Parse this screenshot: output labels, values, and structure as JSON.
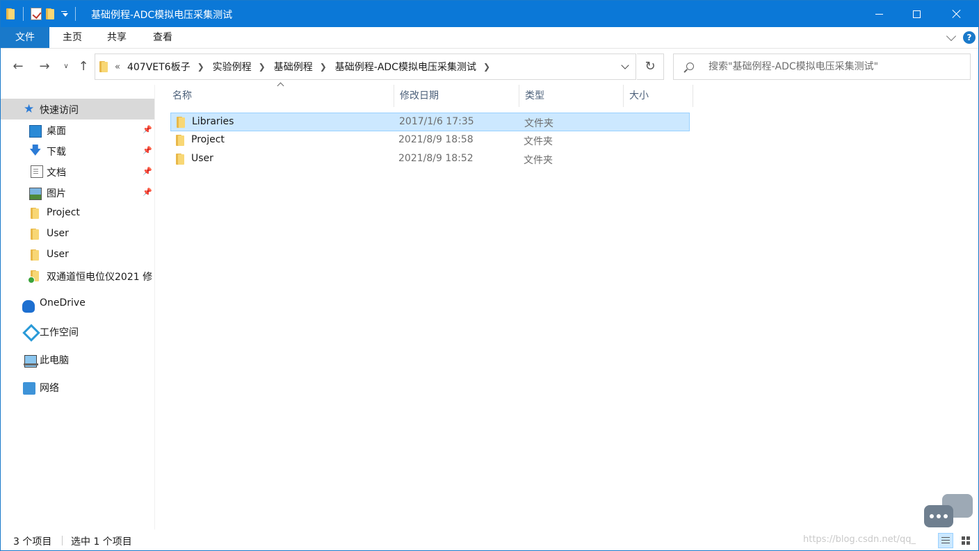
{
  "window": {
    "title": "基础例程-ADC模拟电压采集测试"
  },
  "ribbon": {
    "tabs": [
      {
        "label": "文件"
      },
      {
        "label": "主页"
      },
      {
        "label": "共享"
      },
      {
        "label": "查看"
      }
    ],
    "help": "?"
  },
  "navigation": {
    "overflow": "«",
    "breadcrumbs": [
      {
        "label": "407VET6板子"
      },
      {
        "label": "实验例程"
      },
      {
        "label": "基础例程"
      },
      {
        "label": "基础例程-ADC模拟电压采集测试"
      }
    ],
    "search_placeholder": "搜索\"基础例程-ADC模拟电压采集测试\""
  },
  "sidebar": {
    "items": [
      {
        "label": "快速访问",
        "icon": "star-icon"
      },
      {
        "label": "桌面",
        "icon": "desktop-icon",
        "pinned": true
      },
      {
        "label": "下载",
        "icon": "download-icon",
        "pinned": true
      },
      {
        "label": "文档",
        "icon": "documents-icon",
        "pinned": true
      },
      {
        "label": "图片",
        "icon": "pictures-icon",
        "pinned": true
      },
      {
        "label": "Project",
        "icon": "folder-icon"
      },
      {
        "label": "User",
        "icon": "folder-icon"
      },
      {
        "label": "User",
        "icon": "folder-icon"
      },
      {
        "label": "双通道恒电位仪2021 修",
        "icon": "folder-synced-icon"
      },
      {
        "label": "OneDrive",
        "icon": "onedrive-icon"
      },
      {
        "label": "工作空间",
        "icon": "workspace-icon"
      },
      {
        "label": "此电脑",
        "icon": "this-pc-icon"
      },
      {
        "label": "网络",
        "icon": "network-icon"
      }
    ]
  },
  "filelist": {
    "columns": {
      "name": "名称",
      "date": "修改日期",
      "type": "类型",
      "size": "大小"
    },
    "rows": [
      {
        "name": "Libraries",
        "date": "2017/1/6 17:35",
        "type": "文件夹",
        "selected": true
      },
      {
        "name": "Project",
        "date": "2021/8/9 18:58",
        "type": "文件夹"
      },
      {
        "name": "User",
        "date": "2021/8/9 18:52",
        "type": "文件夹"
      }
    ]
  },
  "status": {
    "count": "3 个项目",
    "selected": "选中 1 个项目",
    "watermark": "https://blog.csdn.net/qq_"
  },
  "colors": {
    "titlebar": "#0b78d7",
    "selection": "#cce8ff",
    "accent": "#1979ca"
  }
}
